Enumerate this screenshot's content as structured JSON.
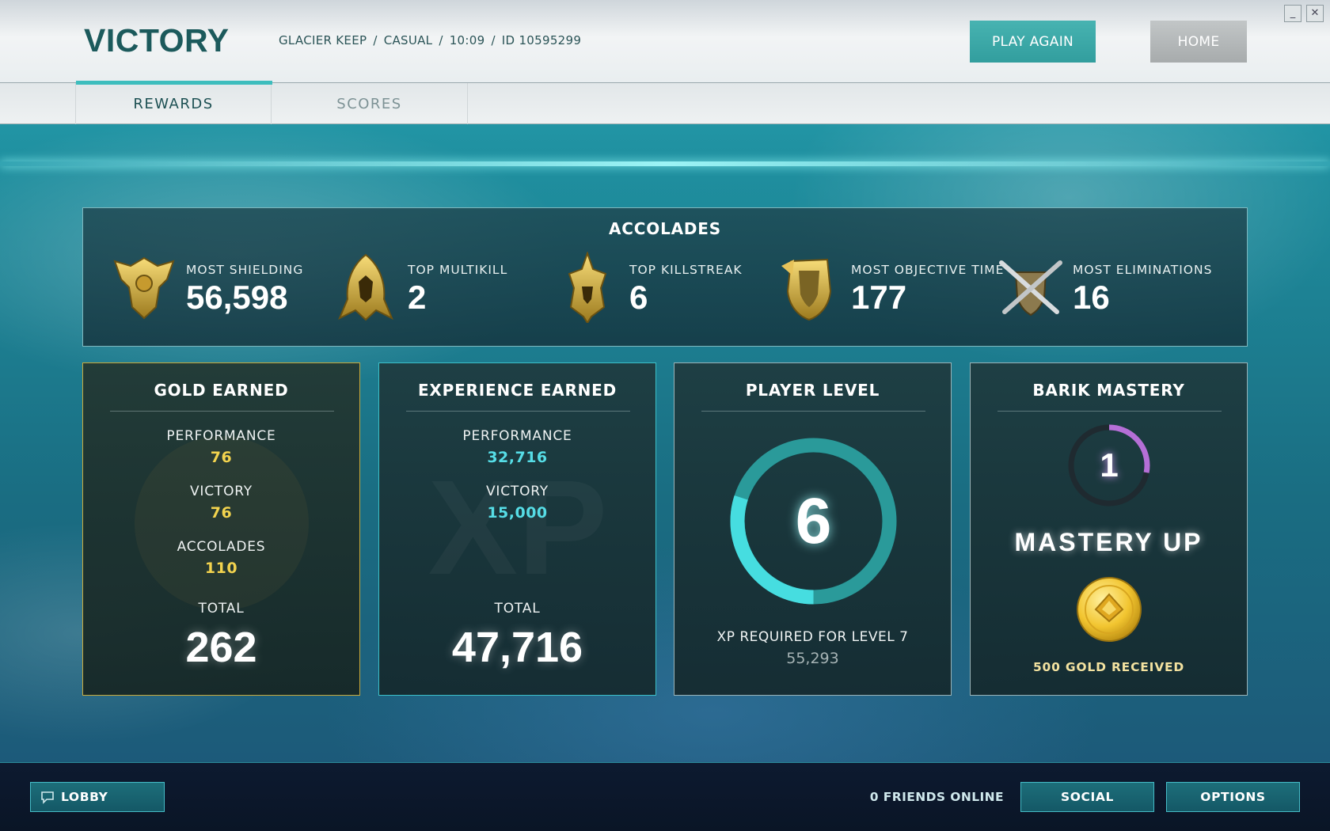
{
  "header": {
    "title": "VICTORY",
    "match_info": {
      "map": "GLACIER KEEP",
      "mode": "CASUAL",
      "duration": "10:09",
      "match_id": "ID 10595299",
      "separator": "/"
    },
    "play_again_label": "PLAY AGAIN",
    "home_label": "HOME",
    "window_controls": {
      "minimize": "_",
      "close": "✕"
    }
  },
  "tabs": [
    {
      "label": "REWARDS",
      "active": true
    },
    {
      "label": "SCORES",
      "active": false
    }
  ],
  "accolades": {
    "title": "ACCOLADES",
    "items": [
      {
        "label": "MOST SHIELDING",
        "value": "56,598",
        "icon": "shield-crest-icon"
      },
      {
        "label": "TOP MULTIKILL",
        "value": "2",
        "icon": "golden-helm-icon"
      },
      {
        "label": "TOP KILLSTREAK",
        "value": "6",
        "icon": "spiked-helm-icon"
      },
      {
        "label": "MOST OBJECTIVE TIME",
        "value": "177",
        "icon": "winged-shield-icon"
      },
      {
        "label": "MOST ELIMINATIONS",
        "value": "16",
        "icon": "crossed-swords-icon"
      }
    ]
  },
  "gold_earned": {
    "title": "GOLD EARNED",
    "performance_label": "PERFORMANCE",
    "performance_value": "76",
    "victory_label": "VICTORY",
    "victory_value": "76",
    "accolades_label": "ACCOLADES",
    "accolades_value": "110",
    "total_label": "TOTAL",
    "total_value": "262",
    "accent_color": "#f2d34e"
  },
  "experience_earned": {
    "title": "EXPERIENCE EARNED",
    "performance_label": "PERFORMANCE",
    "performance_value": "32,716",
    "victory_label": "VICTORY",
    "victory_value": "15,000",
    "total_label": "TOTAL",
    "total_value": "47,716",
    "accent_color": "#56dde6"
  },
  "player_level": {
    "title": "PLAYER LEVEL",
    "level": "6",
    "xp_required_label": "XP REQUIRED FOR LEVEL 7",
    "xp_required_value": "55,293",
    "progress_fraction": 0.48,
    "ring_color": "#2a9a9a",
    "progress_color": "#46dde0"
  },
  "mastery": {
    "title": "BARIK MASTERY",
    "level": "1",
    "progress_fraction": 0.28,
    "ring_color": "#b56fd6",
    "mastery_up_label": "MASTERY UP",
    "reward_label": "500 GOLD RECEIVED",
    "reward_icon": "gold-coin-icon"
  },
  "footer": {
    "lobby_label": "LOBBY",
    "friends_online": "0 FRIENDS ONLINE",
    "social_label": "SOCIAL",
    "options_label": "OPTIONS"
  }
}
